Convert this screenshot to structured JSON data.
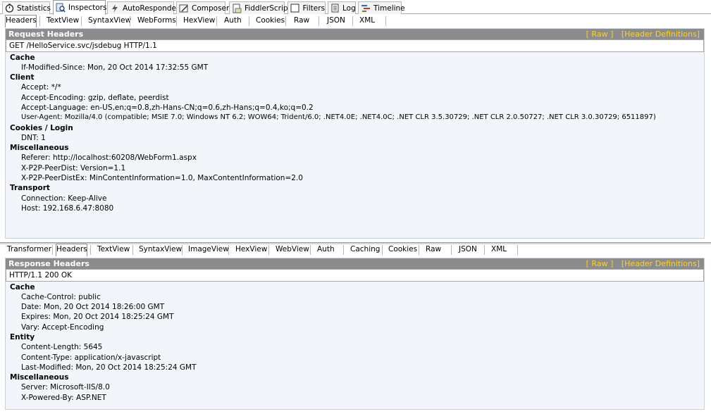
{
  "top_tabs": [
    {
      "label": "Statistics",
      "icon": "stopwatch-icon"
    },
    {
      "label": "Inspectors",
      "icon": "inspect-icon",
      "active": true
    },
    {
      "label": "AutoResponder",
      "icon": "lightning-icon"
    },
    {
      "label": "Composer",
      "icon": "composer-icon"
    },
    {
      "label": "FiddlerScript",
      "icon": "script-icon"
    },
    {
      "label": "Filters",
      "icon": "checkbox-icon"
    },
    {
      "label": "Log",
      "icon": "log-icon"
    },
    {
      "label": "Timeline",
      "icon": "timeline-icon"
    }
  ],
  "request": {
    "tabs": [
      "Headers",
      "TextView",
      "SyntaxView",
      "WebForms",
      "HexView",
      "Auth",
      "Cookies",
      "Raw",
      "JSON",
      "XML"
    ],
    "title": "Request Headers",
    "link_raw": "[ Raw ]",
    "link_defs": "[Header Definitions]",
    "request_line": "GET /HelloService.svc/jsdebug HTTP/1.1",
    "groups": [
      {
        "name": "Cache",
        "items": [
          "If-Modified-Since: Mon, 20 Oct 2014 17:32:55 GMT"
        ]
      },
      {
        "name": "Client",
        "items": [
          "Accept: */*",
          "Accept-Encoding: gzip, deflate, peerdist",
          "Accept-Language: en-US,en;q=0.8,zh-Hans-CN;q=0.6,zh-Hans;q=0.4,ko;q=0.2",
          "User-Agent: Mozilla/4.0 (compatible; MSIE 7.0; Windows NT 6.2; WOW64; Trident/6.0; .NET4.0E; .NET4.0C; .NET CLR 3.5.30729; .NET CLR 2.0.50727; .NET CLR 3.0.30729; 6511897)"
        ]
      },
      {
        "name": "Cookies / Login",
        "items": [
          "DNT: 1"
        ]
      },
      {
        "name": "Miscellaneous",
        "items": [
          "Referer: http://localhost:60208/WebForm1.aspx",
          "X-P2P-PeerDist: Version=1.1",
          "X-P2P-PeerDistEx: MinContentInformation=1.0, MaxContentInformation=2.0"
        ]
      },
      {
        "name": "Transport",
        "items": [
          "Connection: Keep-Alive",
          "Host: 192.168.6.47:8080"
        ]
      }
    ]
  },
  "response": {
    "tabs": [
      "Transformer",
      "Headers",
      "TextView",
      "SyntaxView",
      "ImageView",
      "HexView",
      "WebView",
      "Auth",
      "Caching",
      "Cookies",
      "Raw",
      "JSON",
      "XML"
    ],
    "title": "Response Headers",
    "link_raw": "[ Raw ]",
    "link_defs": "[Header Definitions]",
    "status_line": "HTTP/1.1 200 OK",
    "groups": [
      {
        "name": "Cache",
        "items": [
          "Cache-Control: public",
          "Date: Mon, 20 Oct 2014 18:26:00 GMT",
          "Expires: Mon, 20 Oct 2014 18:25:24 GMT",
          "Vary: Accept-Encoding"
        ]
      },
      {
        "name": "Entity",
        "items": [
          "Content-Length: 5645",
          "Content-Type: application/x-javascript",
          "Last-Modified: Mon, 20 Oct 2014 18:25:24 GMT"
        ]
      },
      {
        "name": "Miscellaneous",
        "items": [
          "Server: Microsoft-IIS/8.0",
          "X-Powered-By: ASP.NET"
        ]
      }
    ]
  }
}
